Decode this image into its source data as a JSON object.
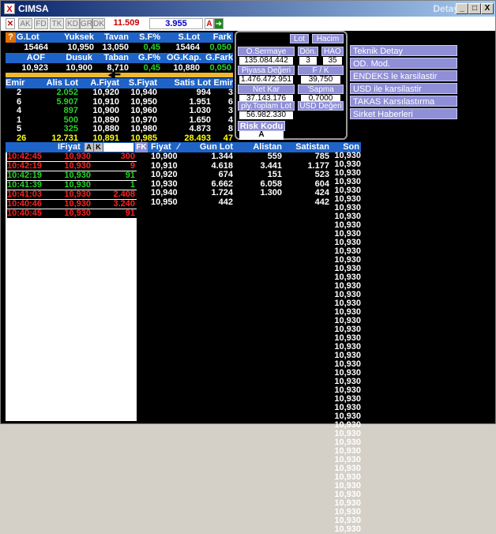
{
  "window": {
    "title": "CIMSA",
    "right_title": "Detay",
    "min_label": "_",
    "max_label": "□",
    "close_label": "X",
    "app_icon": "X"
  },
  "toolbar": {
    "buttons": [
      "AK",
      "FD",
      "TK",
      "KD",
      "GR",
      "DK"
    ],
    "price1": "11.509",
    "price2": "3.955",
    "a_label": "A",
    "colors": {
      "price1": "#cc0000",
      "price2": "#0000cc"
    }
  },
  "summary": {
    "icon": "?",
    "headers1": [
      "G.Lot",
      "Yuksek",
      "Tavan",
      "S.F%",
      "S.Lot",
      "Fark"
    ],
    "values1": [
      "15464",
      "10,950",
      "13,050",
      "0,45",
      "15464",
      "0,050"
    ],
    "headers2": [
      "AOF",
      "Dusuk",
      "Taban",
      "G.F%",
      "OG.Kap.",
      "G.Fark"
    ],
    "values2": [
      "10,923",
      "10,900",
      "8,710",
      "0,45",
      "10,880",
      "0,050"
    ]
  },
  "depth": {
    "headers": [
      "Emir",
      "Alis Lot",
      "A.Fiyat",
      "S.Fiyat",
      "Satis Lot",
      "Emir"
    ],
    "rows": [
      [
        "2",
        "2.052",
        "10,920",
        "10,940",
        "994",
        "3"
      ],
      [
        "6",
        "5.907",
        "10,910",
        "10,950",
        "1.951",
        "6"
      ],
      [
        "4",
        "897",
        "10,900",
        "10,960",
        "1.030",
        "3"
      ],
      [
        "1",
        "500",
        "10,890",
        "10,970",
        "1.650",
        "4"
      ],
      [
        "5",
        "325",
        "10,880",
        "10,980",
        "4.873",
        "8"
      ]
    ],
    "totals": [
      "26",
      "12.731",
      "10,891",
      "10,985",
      "28.493",
      "47"
    ]
  },
  "ticks": {
    "header": "IFiyat",
    "a_btn": "A",
    "k_btn": "K",
    "fk_btn": "FK",
    "rows": [
      {
        "time": "10:42:45",
        "price": "10,930",
        "lot": "300",
        "color": "red"
      },
      {
        "time": "10:42:19",
        "price": "10,930",
        "lot": "9",
        "color": "red"
      },
      {
        "time": "10:42:19",
        "price": "10,930",
        "lot": "91",
        "color": "green"
      },
      {
        "time": "10:41:39",
        "price": "10,930",
        "lot": "1",
        "color": "green"
      },
      {
        "time": "10:41:03",
        "price": "10,930",
        "lot": "2.408",
        "color": "red"
      },
      {
        "time": "10:40:46",
        "price": "10,930",
        "lot": "3.240",
        "color": "red"
      },
      {
        "time": "10:40:45",
        "price": "10,930",
        "lot": "91",
        "color": "red"
      }
    ]
  },
  "levels": {
    "headers": [
      "Fiyat",
      "Gun Lot",
      "Alistan",
      "Satistan",
      "Son"
    ],
    "rows": [
      [
        "10,900",
        "1.344",
        "559",
        "785"
      ],
      [
        "10,910",
        "4.618",
        "3.441",
        "1.177"
      ],
      [
        "10,920",
        "674",
        "151",
        "523"
      ],
      [
        "10,930",
        "6.662",
        "6.058",
        "604"
      ],
      [
        "10,940",
        "1.724",
        "1.300",
        "424"
      ],
      [
        "10,950",
        "442",
        "",
        "442"
      ]
    ],
    "son_value": "10,930",
    "son_count": 44
  },
  "popup": {
    "lot": "Lot",
    "hacim": "Hacim",
    "o_sermaye_label": "O.Sermaye",
    "o_sermaye": "135.084.442",
    "don_label": "Dön.",
    "don": "3",
    "hao_label": "HAO",
    "hao": "35",
    "piyasa_label": "Piyasa Değeri",
    "piyasa": "1.476.472.951",
    "fk_label": "F / K",
    "fk": "39,750",
    "netkar_label": "Net Kar",
    "netkar": "37.143.176",
    "sapma_label": "'Sapma",
    "sapma": "0,7000",
    "toplam_label": "ply.Toplam Lot",
    "toplam": "56.982.330",
    "usd_label": "USD Değeri",
    "risk_label": "Risk Kodu",
    "risk": "A"
  },
  "menu": [
    "Teknik Detay",
    "OD. Mod.",
    "ENDEKS le karsilastir",
    "USD ile karsilastir",
    "TAKAS Karsılastırma",
    "Sirket Haberleri"
  ]
}
